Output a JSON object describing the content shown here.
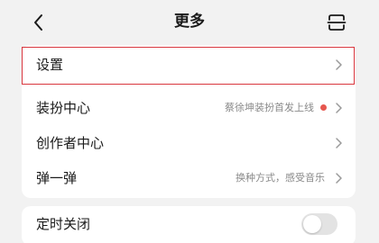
{
  "header": {
    "title": "更多",
    "back_icon": "chevron-left-icon",
    "scan_icon": "scan-icon"
  },
  "menu": {
    "settings": {
      "label": "设置"
    },
    "dress_up": {
      "label": "装扮中心",
      "subtitle": "蔡徐坤装扮首发上线",
      "dot_color": "#e6574f"
    },
    "creator": {
      "label": "创作者中心"
    },
    "danmaku": {
      "label": "弹一弹",
      "subtitle": "换种方式，感受音乐"
    }
  },
  "timer": {
    "label": "定时关闭",
    "enabled": false
  },
  "colors": {
    "highlight_border": "#d9363e",
    "background": "#f2f2f2"
  }
}
